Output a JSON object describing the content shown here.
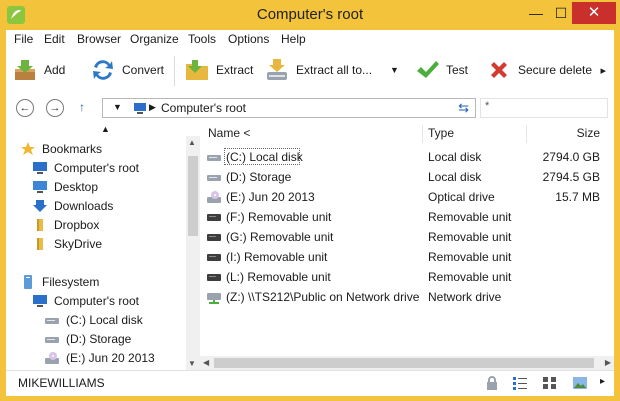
{
  "window": {
    "title": "Computer's root",
    "min_glyph": "—",
    "max_glyph": "☐",
    "close_glyph": "✕"
  },
  "menu": [
    "File",
    "Edit",
    "Browser",
    "Organize",
    "Tools",
    "Options",
    "Help"
  ],
  "toolbar": {
    "add": "Add",
    "convert": "Convert",
    "extract": "Extract",
    "extract_all": "Extract all to...",
    "test": "Test",
    "secure_delete": "Secure delete",
    "more_glyph": "▸"
  },
  "address": {
    "path": "Computer's root",
    "filter_glyph": "*"
  },
  "tree": {
    "bookmarks_label": "Bookmarks",
    "bookmarks": [
      "Computer's root",
      "Desktop",
      "Downloads",
      "Dropbox",
      "SkyDrive"
    ],
    "filesystem_label": "Filesystem",
    "filesystem": [
      "Computer's root",
      "(C:) Local disk",
      "(D:) Storage",
      "(E:) Jun 20 2013"
    ]
  },
  "columns": {
    "name": "Name <",
    "type": "Type",
    "size": "Size"
  },
  "rows": [
    {
      "name": "(C:) Local disk",
      "type": "Local disk",
      "size": "2794.0 GB",
      "icon": "hdd-icon"
    },
    {
      "name": "(D:) Storage",
      "type": "Local disk",
      "size": "2794.5 GB",
      "icon": "hdd-icon"
    },
    {
      "name": "(E:) Jun 20 2013",
      "type": "Optical drive",
      "size": "15.7 MB",
      "icon": "optical-drive-icon"
    },
    {
      "name": "(F:) Removable unit",
      "type": "Removable unit",
      "size": "",
      "icon": "removable-drive-icon"
    },
    {
      "name": "(G:) Removable unit",
      "type": "Removable unit",
      "size": "",
      "icon": "removable-drive-icon"
    },
    {
      "name": "(I:) Removable unit",
      "type": "Removable unit",
      "size": "",
      "icon": "removable-drive-icon"
    },
    {
      "name": "(L:) Removable unit",
      "type": "Removable unit",
      "size": "",
      "icon": "removable-drive-icon"
    },
    {
      "name": "(Z:) \\\\TS212\\Public on Network drive",
      "type": "Network drive",
      "size": "",
      "icon": "network-drive-icon"
    }
  ],
  "status": {
    "user": "MIKEWILLIAMS"
  },
  "colors": {
    "frame": "#f3c43b",
    "close": "#c9302c",
    "accent": "#1f5fb3"
  }
}
